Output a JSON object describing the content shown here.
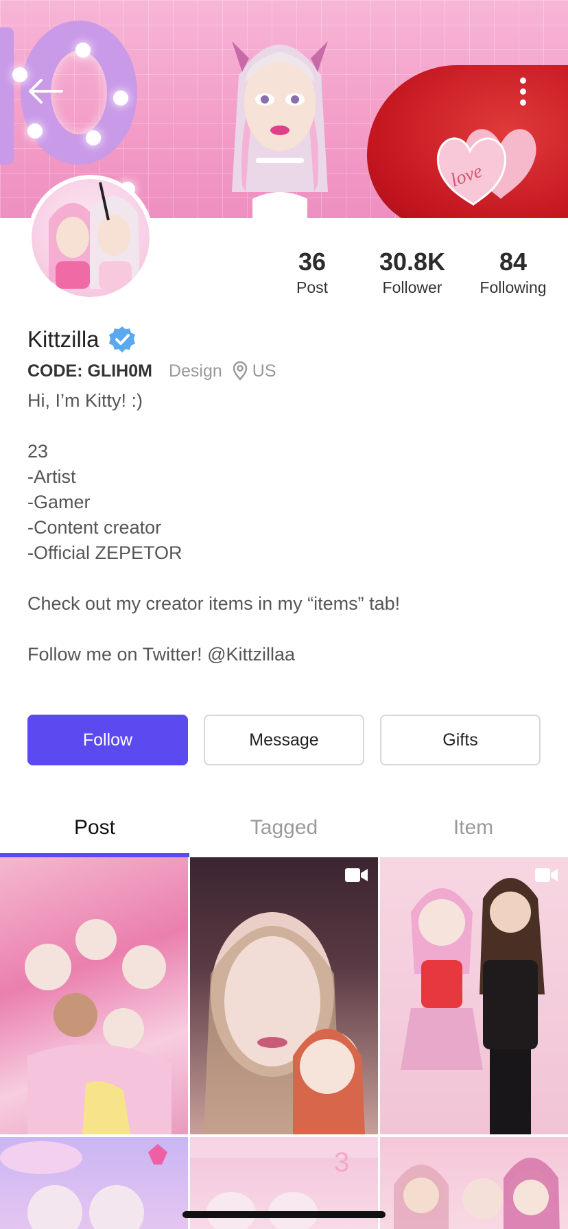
{
  "header": {
    "back_icon": "arrow-left-icon",
    "more_icon": "more-vertical-icon",
    "banner_text": "love"
  },
  "profile": {
    "name": "Kittzilla",
    "verified": true,
    "code": "CODE: GLIH0M",
    "category": "Design",
    "location": "US",
    "bio_lines": [
      "Hi, I’m Kitty! :)",
      "",
      "23",
      "-Artist",
      "-Gamer",
      "-Content creator",
      "-Official ZEPETOR",
      "",
      "Check out my creator items in my “items” tab!",
      "",
      "Follow me on Twitter! @Kittzillaa"
    ]
  },
  "stats": [
    {
      "value": "36",
      "label": "Post"
    },
    {
      "value": "30.8K",
      "label": "Follower"
    },
    {
      "value": "84",
      "label": "Following"
    }
  ],
  "actions": {
    "follow": "Follow",
    "message": "Message",
    "gifts": "Gifts"
  },
  "tabs": [
    {
      "label": "Post",
      "active": true
    },
    {
      "label": "Tagged",
      "active": false
    },
    {
      "label": "Item",
      "active": false
    }
  ],
  "colors": {
    "accent": "#5b4af0",
    "verified": "#5aa8f0"
  }
}
